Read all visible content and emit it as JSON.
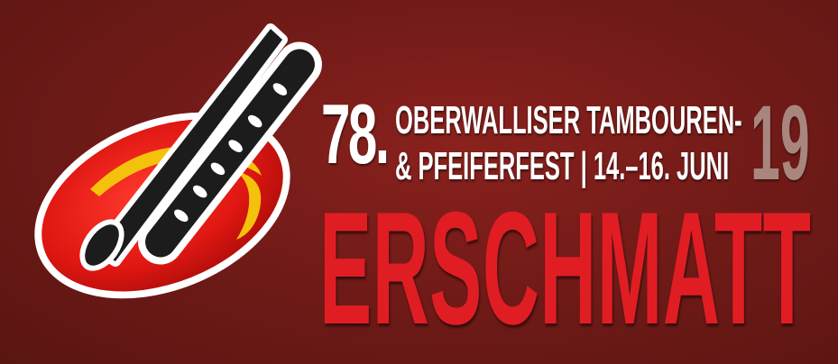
{
  "edition": "78.",
  "line1": "OBERWALLISER TAMBOUREN-",
  "line2": "& PFEIFERFEST | 14.–16. JUNI",
  "year_suffix": "19",
  "place": "ERSCHMATT",
  "colors": {
    "background": "#6b1a17",
    "red": "#e11d24",
    "yellow": "#f4c20d",
    "white": "#ffffff",
    "year": "#a8867d"
  },
  "logo_icon": "drum-fife-sticks-logo"
}
